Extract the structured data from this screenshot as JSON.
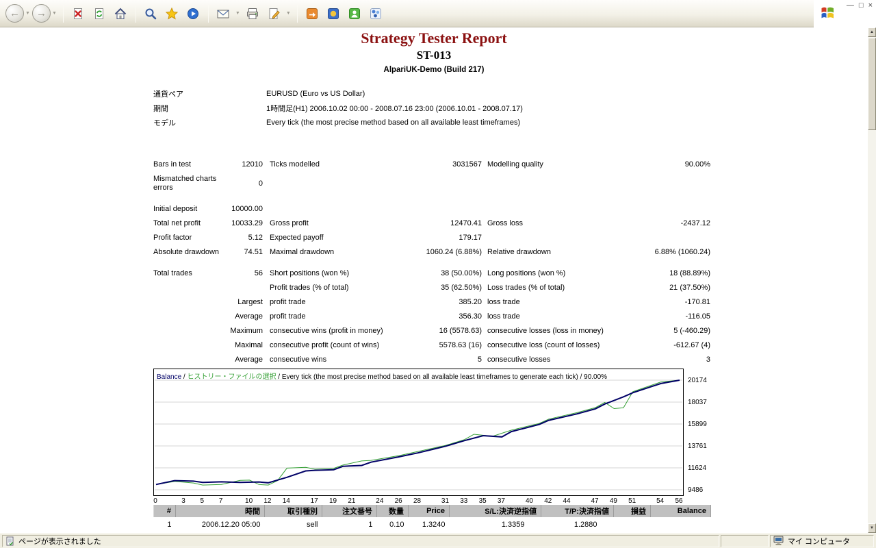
{
  "win": {
    "minimize": "—",
    "restore": "□",
    "close": "×"
  },
  "toolbar": {
    "buttons": [
      "back",
      "forward",
      "stop",
      "refresh",
      "home",
      "search",
      "favorites",
      "media",
      "mail",
      "print",
      "edit",
      "messenger",
      "translate",
      "msn-messenger",
      "research"
    ]
  },
  "colors": {
    "title": "#8b1111",
    "balance_line": "#000066",
    "equity_line": "#35a035",
    "table_header_bg": "#c0c0c0"
  },
  "report": {
    "title": "Strategy Tester Report",
    "subtitle": "ST-013",
    "account": "AlpariUK-Demo (Build 217)",
    "info": [
      {
        "label": "通貨ペア",
        "value": "EURUSD (Euro vs US Dollar)"
      },
      {
        "label": "期間",
        "value": "1時間足(H1) 2006.10.02 00:00 - 2008.07.16 23:00 (2006.10.01 - 2008.07.17)"
      },
      {
        "label": "モデル",
        "value": "Every tick (the most precise method based on all available least timeframes)"
      }
    ]
  },
  "stats": {
    "rows": [
      {
        "gap": false,
        "cells": [
          "Bars in test",
          "12010",
          "Ticks modelled",
          "3031567",
          "Modelling quality",
          "90.00%"
        ]
      },
      {
        "gap": false,
        "cells": [
          "Mismatched charts errors",
          "0",
          "",
          "",
          "",
          ""
        ]
      },
      {
        "gap": true,
        "cells": [
          "Initial deposit",
          "10000.00",
          "",
          "",
          "",
          ""
        ]
      },
      {
        "gap": false,
        "cells": [
          "Total net profit",
          "10033.29",
          "Gross profit",
          "12470.41",
          "Gross loss",
          "-2437.12"
        ]
      },
      {
        "gap": false,
        "cells": [
          "Profit factor",
          "5.12",
          "Expected payoff",
          "179.17",
          "",
          ""
        ]
      },
      {
        "gap": false,
        "cells": [
          "Absolute drawdown",
          "74.51",
          "Maximal drawdown",
          "1060.24 (6.88%)",
          "Relative drawdown",
          "6.88% (1060.24)"
        ]
      },
      {
        "gap": true,
        "cells": [
          "Total trades",
          "56",
          "Short positions (won %)",
          "38 (50.00%)",
          "Long positions (won %)",
          "18 (88.89%)"
        ]
      },
      {
        "gap": false,
        "cells": [
          "",
          "",
          "Profit trades (% of total)",
          "35 (62.50%)",
          "Loss trades (% of total)",
          "21 (37.50%)"
        ]
      },
      {
        "gap": false,
        "cells": [
          "",
          "Largest",
          "profit trade",
          "385.20",
          "loss trade",
          "-170.81"
        ]
      },
      {
        "gap": false,
        "cells": [
          "",
          "Average",
          "profit trade",
          "356.30",
          "loss trade",
          "-116.05"
        ]
      },
      {
        "gap": false,
        "cells": [
          "",
          "Maximum",
          "consecutive wins (profit in money)",
          "16 (5578.63)",
          "consecutive losses (loss in money)",
          "5 (-460.29)"
        ]
      },
      {
        "gap": false,
        "cells": [
          "",
          "Maximal",
          "consecutive profit (count of wins)",
          "5578.63 (16)",
          "consecutive loss (count of losses)",
          "-612.67 (4)"
        ]
      },
      {
        "gap": false,
        "cells": [
          "",
          "Average",
          "consecutive wins",
          "5",
          "consecutive losses",
          "3"
        ]
      }
    ]
  },
  "chart_data": {
    "type": "line",
    "legend_parts": [
      {
        "text": "Balance",
        "color": "#000066"
      },
      {
        "text": " / ",
        "color": "#000000"
      },
      {
        "text": "ヒストリー・ファイルの選択",
        "color": "#35a035"
      },
      {
        "text": " / Every tick (the most precise method based on all available least timeframes to generate each tick) / 90.00%",
        "color": "#000000"
      }
    ],
    "x_ticks": [
      0,
      3,
      5,
      7,
      10,
      12,
      14,
      17,
      19,
      21,
      24,
      26,
      28,
      31,
      33,
      35,
      37,
      40,
      42,
      44,
      47,
      49,
      51,
      54,
      56
    ],
    "y_ticks": [
      20174,
      18037,
      15899,
      13761,
      11624,
      9486
    ],
    "xlim": [
      0,
      56
    ],
    "ylim": [
      9486,
      20174
    ],
    "grid": true,
    "legend_position": "top-left",
    "series": [
      {
        "name": "Equity",
        "color": "#35a035",
        "width": 1,
        "x": [
          0,
          2,
          4,
          5,
          7,
          9,
          10,
          11,
          12,
          13,
          14,
          16,
          17,
          19,
          20,
          22,
          23,
          26,
          28,
          31,
          33,
          34,
          36,
          38,
          41,
          42,
          45,
          47,
          48,
          49,
          50,
          51,
          53,
          54,
          56
        ],
        "y": [
          10000,
          10300,
          10150,
          9950,
          10000,
          10400,
          10430,
          10000,
          9950,
          10380,
          11600,
          11680,
          11500,
          11580,
          11900,
          12300,
          12350,
          12820,
          13220,
          13820,
          14380,
          14900,
          14700,
          15300,
          15960,
          16380,
          17000,
          17500,
          18000,
          17400,
          17480,
          19050,
          19680,
          20000,
          20174
        ]
      },
      {
        "name": "Balance",
        "color": "#000066",
        "width": 2,
        "x": [
          0,
          2,
          4,
          5,
          7,
          9,
          11,
          12,
          14,
          16,
          17,
          19,
          20,
          22,
          23,
          26,
          28,
          31,
          33,
          35,
          37,
          38,
          41,
          42,
          45,
          47,
          48,
          50,
          51,
          53,
          54,
          56
        ],
        "y": [
          10000,
          10380,
          10330,
          10200,
          10260,
          10210,
          10250,
          10170,
          10700,
          11320,
          11380,
          11440,
          11780,
          11860,
          12180,
          12700,
          13080,
          13740,
          14280,
          14760,
          14640,
          15160,
          15860,
          16260,
          16880,
          17380,
          17850,
          18550,
          18950,
          19550,
          19850,
          20174
        ]
      }
    ]
  },
  "trades": {
    "headers": [
      "#",
      "時間",
      "取引種別",
      "注文番号",
      "数量",
      "Price",
      "S/L:決済逆指値",
      "T/P:決済指値",
      "損益",
      "Balance"
    ],
    "rows": [
      [
        "1",
        "2006.12.20 05:00",
        "sell",
        "1",
        "0.10",
        "1.3240",
        "1.3359",
        "1.2880",
        "",
        ""
      ]
    ]
  },
  "statusbar": {
    "status_text": "ページが表示されました",
    "zone_text": "マイ コンピュータ"
  }
}
